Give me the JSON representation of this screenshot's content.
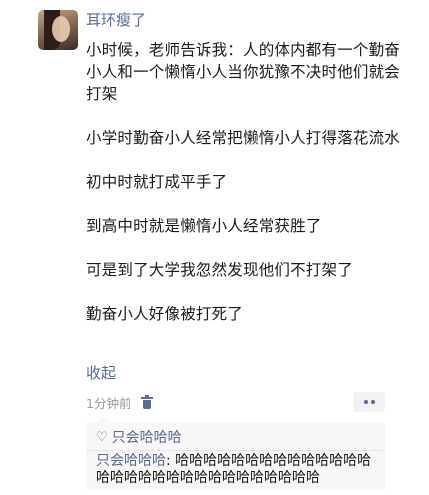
{
  "post": {
    "username": "耳环瘦了",
    "paragraphs": [
      "小时候，老师告诉我：人的体内都有一个勤奋小人和一个懒惰小人当你犹豫不决时他们就会打架",
      "小学时勤奋小人经常把懒惰小人打得落花流水",
      "初中时就打成平手了",
      "到高中时就是懒惰小人经常获胜了",
      "可是到了大学我忽然发现他们不打架了",
      "勤奋小人好像被打死了"
    ],
    "collapse_label": "收起",
    "timestamp": "1分钟前",
    "icons": {
      "delete": "trash-icon",
      "more": "more-dots-icon",
      "like": "heart-icon"
    }
  },
  "interactions": {
    "likes": "只会哈哈哈",
    "comment_author": "只会哈哈哈",
    "comment_separator": ": ",
    "comment_text": "哈哈哈哈哈哈哈哈哈哈哈哈哈哈哈哈哈哈哈哈哈哈哈哈哈哈哈哈哈哈"
  },
  "colors": {
    "link": "#576b95",
    "text": "#1a1a1a",
    "meta": "#9a9a9a",
    "comment_bg": "#f7f7f7"
  }
}
